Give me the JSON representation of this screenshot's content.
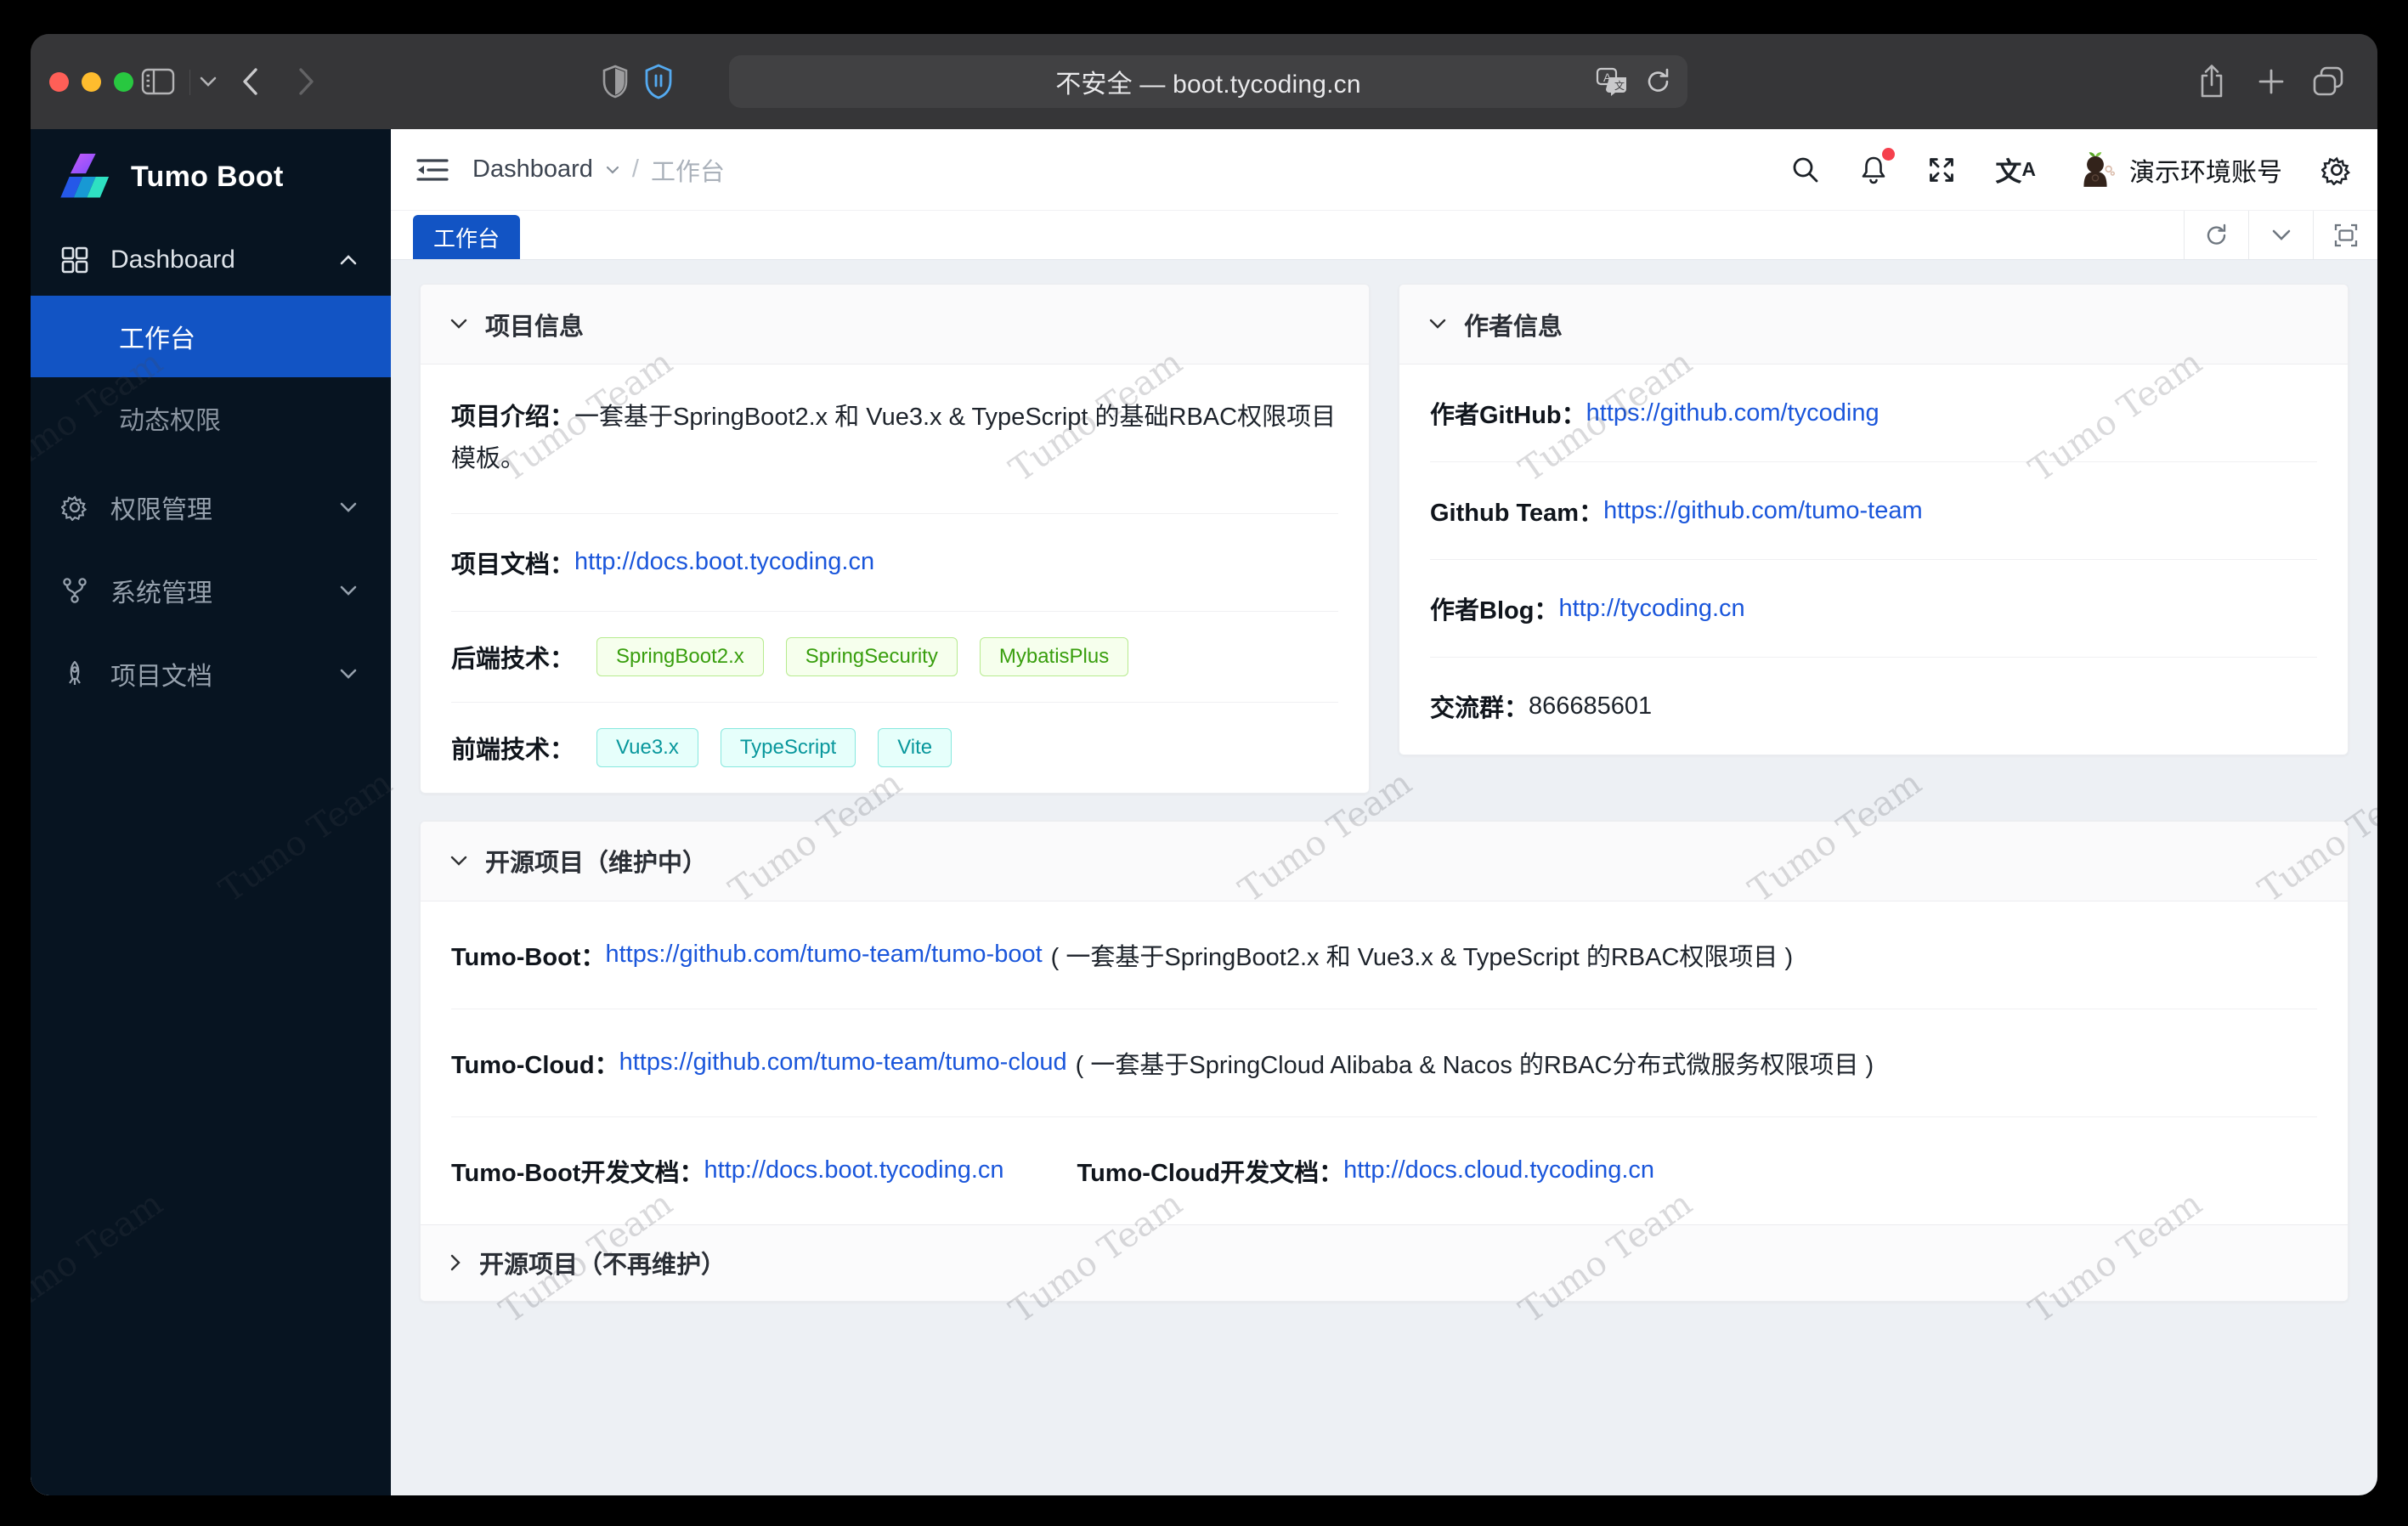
{
  "browser": {
    "address": "不安全 — boot.tycoding.cn"
  },
  "sidebar": {
    "brand": "Tumo Boot",
    "items": [
      {
        "label": "Dashboard"
      },
      {
        "label": "工作台"
      },
      {
        "label": "动态权限"
      },
      {
        "label": "权限管理"
      },
      {
        "label": "系统管理"
      },
      {
        "label": "项目文档"
      }
    ]
  },
  "header": {
    "breadcrumb": [
      "Dashboard",
      "工作台"
    ],
    "account": "演示环境账号",
    "translate_glyph": {
      "zh": "文",
      "en": "A"
    }
  },
  "tabs": {
    "active": "工作台"
  },
  "watermark": {
    "text": "Tumo Team"
  },
  "cards": {
    "project": {
      "title": "项目信息",
      "intro_label": "项目介绍：",
      "intro": "一套基于SpringBoot2.x 和 Vue3.x & TypeScript 的基础RBAC权限项目模板。",
      "doc_label": "项目文档：",
      "doc_link": "http://docs.boot.tycoding.cn",
      "backend_label": "后端技术：",
      "backend_tags": [
        "SpringBoot2.x",
        "SpringSecurity",
        "MybatisPlus"
      ],
      "frontend_label": "前端技术：",
      "frontend_tags": [
        "Vue3.x",
        "TypeScript",
        "Vite"
      ]
    },
    "author": {
      "title": "作者信息",
      "rows": [
        {
          "label": "作者GitHub：",
          "link": "https://github.com/tycoding"
        },
        {
          "label": "Github Team：",
          "link": "https://github.com/tumo-team"
        },
        {
          "label": "作者Blog：",
          "link": "http://tycoding.cn"
        },
        {
          "label": "交流群：",
          "text": "866685601"
        }
      ]
    },
    "opensource": {
      "title": "开源项目（维护中）",
      "rows": [
        {
          "label": "Tumo-Boot：",
          "link": "https://github.com/tumo-team/tumo-boot",
          "desc": "( 一套基于SpringBoot2.x 和 Vue3.x & TypeScript 的RBAC权限项目 )"
        },
        {
          "label": "Tumo-Cloud：",
          "link": "https://github.com/tumo-team/tumo-cloud",
          "desc": "( 一套基于SpringCloud Alibaba & Nacos 的RBAC分布式微服务权限项目 )"
        },
        {
          "label": "Tumo-Boot开发文档：",
          "link": "http://docs.boot.tycoding.cn",
          "label2": "Tumo-Cloud开发文档：",
          "link2": "http://docs.cloud.tycoding.cn"
        }
      ]
    },
    "deprecated": {
      "title": "开源项目（不再维护）"
    }
  },
  "colors": {
    "accent": "#1254C4",
    "link": "#1A56DB",
    "tag_green": "#389E0D",
    "tag_cyan": "#08979C",
    "sidebar_bg": "#071421",
    "notification_dot": "#F5404D"
  }
}
